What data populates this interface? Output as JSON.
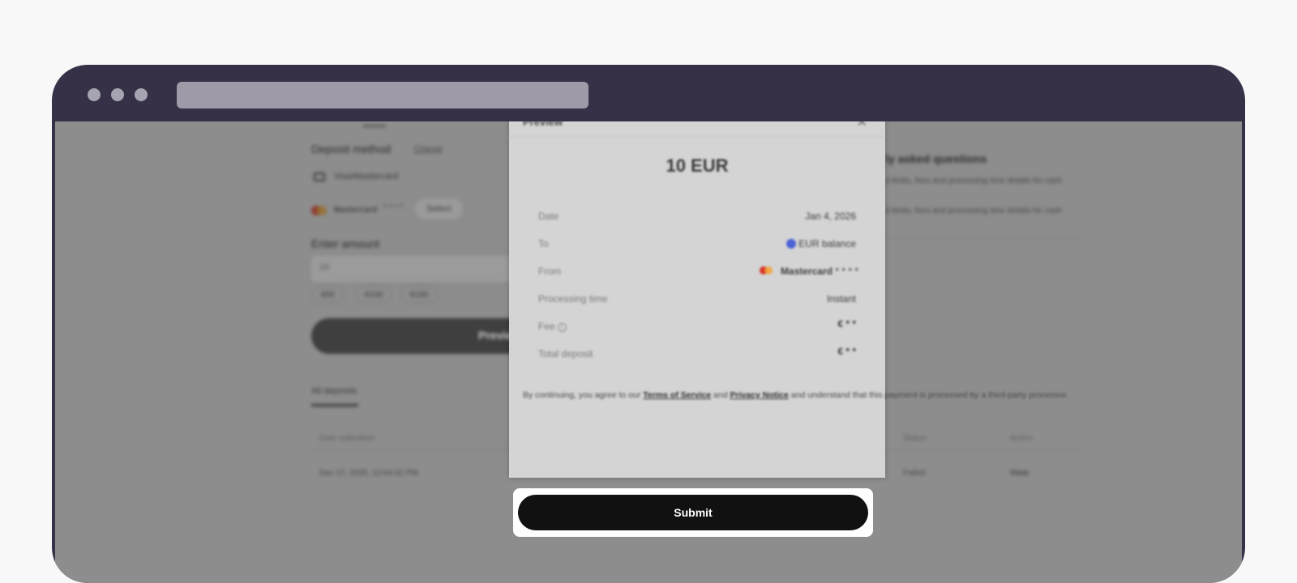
{
  "background": {
    "deposit_method_label": "Deposit method",
    "change_link": "Change",
    "card_type": "Visa/Mastercard",
    "saved_card": "Mastercard",
    "saved_card_mask": "* * * *",
    "select_label": "Select",
    "enter_amount_label": "Enter amount",
    "amount_value": "10",
    "chips": [
      "€50",
      "€100",
      "€150"
    ],
    "preview_button": "Preview",
    "faq_title": "ly asked questions",
    "faq_items": [
      "d limits, fees and processing time details for cash",
      "d limits, fees and processing time details for cash"
    ],
    "tab_all_deposits": "All deposits",
    "table_headers": {
      "date": "Date submitted",
      "status": "Status",
      "action": "Action"
    },
    "table_row": {
      "date": "Dec 17, 2025, 12:04:42 PM",
      "status": "Failed",
      "action": "View"
    }
  },
  "modal": {
    "title": "Preview",
    "close_icon": "close-icon",
    "amount": "10 EUR",
    "rows": [
      {
        "label": "Date",
        "value": "Jan 4, 2026"
      },
      {
        "label": "To",
        "value": "EUR balance"
      },
      {
        "label": "From",
        "value": "Mastercard",
        "mask": "* * * *"
      },
      {
        "label": "Processing time",
        "value": "Instant"
      },
      {
        "label": "Fee",
        "value": "€ * *"
      },
      {
        "label": "Total deposit",
        "value": "€ * *"
      }
    ],
    "terms": {
      "prefix": "By continuing, you agree to our ",
      "tos": "Terms of Service",
      "and": " and ",
      "privacy": "Privacy Notice",
      "suffix": " and understand that this payment is processed by a third-party processor."
    },
    "submit_label": "Submit"
  },
  "colors": {
    "frame": "#363146",
    "submit_bg": "#111111",
    "eur_badge": "#4a62d6"
  }
}
